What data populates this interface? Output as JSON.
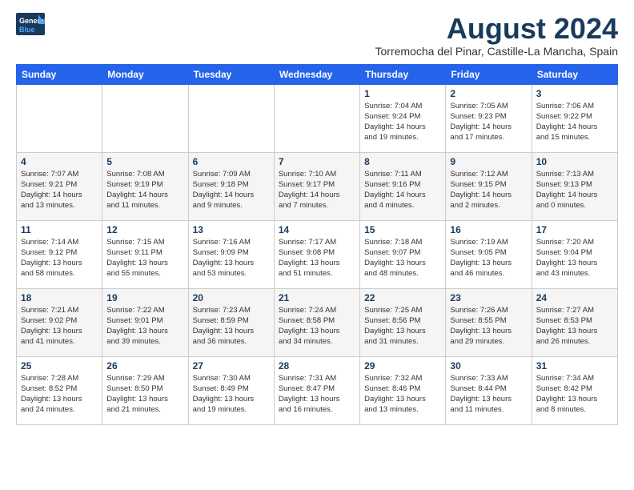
{
  "header": {
    "logo_general": "General",
    "logo_blue": "Blue",
    "month_title": "August 2024",
    "subtitle": "Torremocha del Pinar, Castille-La Mancha, Spain"
  },
  "weekdays": [
    "Sunday",
    "Monday",
    "Tuesday",
    "Wednesday",
    "Thursday",
    "Friday",
    "Saturday"
  ],
  "weeks": [
    [
      {
        "day": "",
        "info": ""
      },
      {
        "day": "",
        "info": ""
      },
      {
        "day": "",
        "info": ""
      },
      {
        "day": "",
        "info": ""
      },
      {
        "day": "1",
        "info": "Sunrise: 7:04 AM\nSunset: 9:24 PM\nDaylight: 14 hours\nand 19 minutes."
      },
      {
        "day": "2",
        "info": "Sunrise: 7:05 AM\nSunset: 9:23 PM\nDaylight: 14 hours\nand 17 minutes."
      },
      {
        "day": "3",
        "info": "Sunrise: 7:06 AM\nSunset: 9:22 PM\nDaylight: 14 hours\nand 15 minutes."
      }
    ],
    [
      {
        "day": "4",
        "info": "Sunrise: 7:07 AM\nSunset: 9:21 PM\nDaylight: 14 hours\nand 13 minutes."
      },
      {
        "day": "5",
        "info": "Sunrise: 7:08 AM\nSunset: 9:19 PM\nDaylight: 14 hours\nand 11 minutes."
      },
      {
        "day": "6",
        "info": "Sunrise: 7:09 AM\nSunset: 9:18 PM\nDaylight: 14 hours\nand 9 minutes."
      },
      {
        "day": "7",
        "info": "Sunrise: 7:10 AM\nSunset: 9:17 PM\nDaylight: 14 hours\nand 7 minutes."
      },
      {
        "day": "8",
        "info": "Sunrise: 7:11 AM\nSunset: 9:16 PM\nDaylight: 14 hours\nand 4 minutes."
      },
      {
        "day": "9",
        "info": "Sunrise: 7:12 AM\nSunset: 9:15 PM\nDaylight: 14 hours\nand 2 minutes."
      },
      {
        "day": "10",
        "info": "Sunrise: 7:13 AM\nSunset: 9:13 PM\nDaylight: 14 hours\nand 0 minutes."
      }
    ],
    [
      {
        "day": "11",
        "info": "Sunrise: 7:14 AM\nSunset: 9:12 PM\nDaylight: 13 hours\nand 58 minutes."
      },
      {
        "day": "12",
        "info": "Sunrise: 7:15 AM\nSunset: 9:11 PM\nDaylight: 13 hours\nand 55 minutes."
      },
      {
        "day": "13",
        "info": "Sunrise: 7:16 AM\nSunset: 9:09 PM\nDaylight: 13 hours\nand 53 minutes."
      },
      {
        "day": "14",
        "info": "Sunrise: 7:17 AM\nSunset: 9:08 PM\nDaylight: 13 hours\nand 51 minutes."
      },
      {
        "day": "15",
        "info": "Sunrise: 7:18 AM\nSunset: 9:07 PM\nDaylight: 13 hours\nand 48 minutes."
      },
      {
        "day": "16",
        "info": "Sunrise: 7:19 AM\nSunset: 9:05 PM\nDaylight: 13 hours\nand 46 minutes."
      },
      {
        "day": "17",
        "info": "Sunrise: 7:20 AM\nSunset: 9:04 PM\nDaylight: 13 hours\nand 43 minutes."
      }
    ],
    [
      {
        "day": "18",
        "info": "Sunrise: 7:21 AM\nSunset: 9:02 PM\nDaylight: 13 hours\nand 41 minutes."
      },
      {
        "day": "19",
        "info": "Sunrise: 7:22 AM\nSunset: 9:01 PM\nDaylight: 13 hours\nand 39 minutes."
      },
      {
        "day": "20",
        "info": "Sunrise: 7:23 AM\nSunset: 8:59 PM\nDaylight: 13 hours\nand 36 minutes."
      },
      {
        "day": "21",
        "info": "Sunrise: 7:24 AM\nSunset: 8:58 PM\nDaylight: 13 hours\nand 34 minutes."
      },
      {
        "day": "22",
        "info": "Sunrise: 7:25 AM\nSunset: 8:56 PM\nDaylight: 13 hours\nand 31 minutes."
      },
      {
        "day": "23",
        "info": "Sunrise: 7:26 AM\nSunset: 8:55 PM\nDaylight: 13 hours\nand 29 minutes."
      },
      {
        "day": "24",
        "info": "Sunrise: 7:27 AM\nSunset: 8:53 PM\nDaylight: 13 hours\nand 26 minutes."
      }
    ],
    [
      {
        "day": "25",
        "info": "Sunrise: 7:28 AM\nSunset: 8:52 PM\nDaylight: 13 hours\nand 24 minutes."
      },
      {
        "day": "26",
        "info": "Sunrise: 7:29 AM\nSunset: 8:50 PM\nDaylight: 13 hours\nand 21 minutes."
      },
      {
        "day": "27",
        "info": "Sunrise: 7:30 AM\nSunset: 8:49 PM\nDaylight: 13 hours\nand 19 minutes."
      },
      {
        "day": "28",
        "info": "Sunrise: 7:31 AM\nSunset: 8:47 PM\nDaylight: 13 hours\nand 16 minutes."
      },
      {
        "day": "29",
        "info": "Sunrise: 7:32 AM\nSunset: 8:46 PM\nDaylight: 13 hours\nand 13 minutes."
      },
      {
        "day": "30",
        "info": "Sunrise: 7:33 AM\nSunset: 8:44 PM\nDaylight: 13 hours\nand 11 minutes."
      },
      {
        "day": "31",
        "info": "Sunrise: 7:34 AM\nSunset: 8:42 PM\nDaylight: 13 hours\nand 8 minutes."
      }
    ]
  ]
}
